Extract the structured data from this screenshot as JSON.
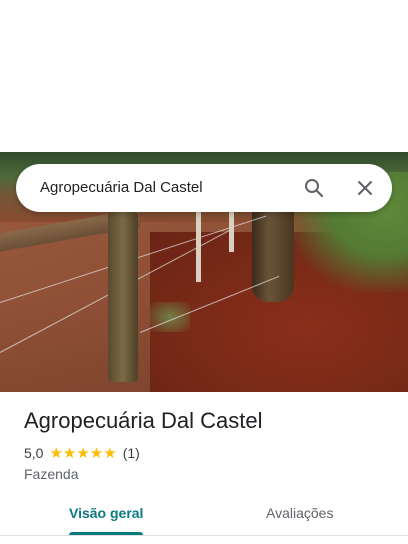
{
  "search": {
    "query": "Agropecuária Dal Castel"
  },
  "place": {
    "name": "Agropecuária Dal Castel",
    "rating": "5,0",
    "stars": "★★★★★",
    "review_count": "(1)",
    "category": "Fazenda"
  },
  "tabs": [
    {
      "label": "Visão geral",
      "selected": true
    },
    {
      "label": "Avaliações",
      "selected": false
    }
  ],
  "colors": {
    "accent": "#0b7a80",
    "star": "#fbbc04"
  },
  "icons": {
    "search": "search-icon",
    "close": "close-icon"
  }
}
